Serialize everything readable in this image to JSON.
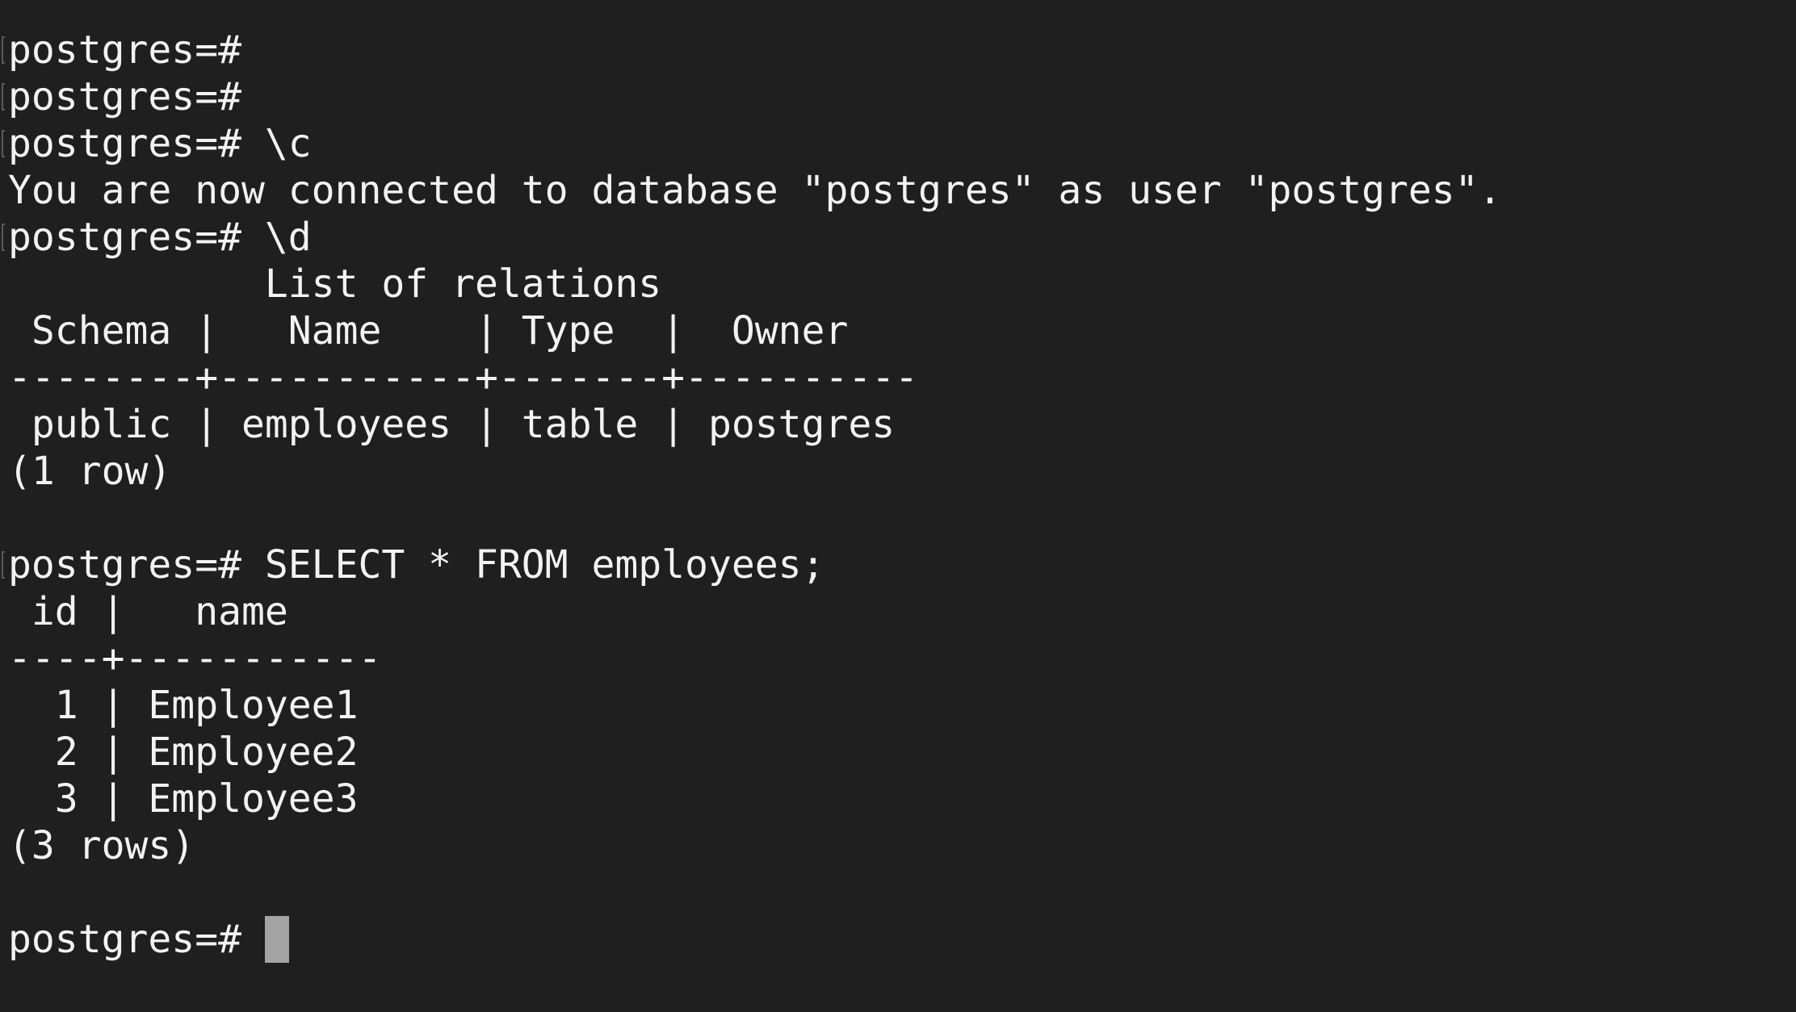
{
  "terminal": {
    "prompt": "postgres=#",
    "lines": [
      "postgres=#",
      "postgres=#",
      "postgres=# \\c",
      "You are now connected to database \"postgres\" as user \"postgres\".",
      "postgres=# \\d",
      "           List of relations",
      " Schema |   Name    | Type  |  Owner",
      "--------+-----------+-------+----------",
      " public | employees | table | postgres",
      "(1 row)",
      "",
      "postgres=# SELECT * FROM employees;",
      " id |   name",
      "----+-----------",
      "  1 | Employee1",
      "  2 | Employee2",
      "  3 | Employee3",
      "(3 rows)",
      ""
    ]
  }
}
